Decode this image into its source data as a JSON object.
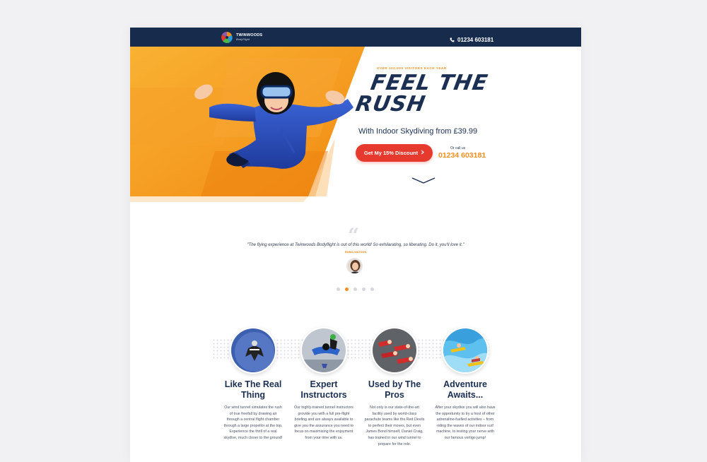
{
  "colors": {
    "navy": "#172c4c",
    "orange": "#f28d1c",
    "cta_red": "#e53a2d",
    "background": "#f1f1f3"
  },
  "header": {
    "logo_name": "TWINWOODS",
    "logo_sub": "BodyFlight",
    "phone_icon": "phone-icon",
    "phone": "01234 603181"
  },
  "hero": {
    "eyebrow": "OVER 100,000 VISITORS EACH YEAR",
    "headline_line1": "FEEL THE",
    "headline_line2": "RUSH",
    "subhead": "With Indoor Skydiving from £39.99",
    "cta_label": "Get My 15% Discount",
    "cta_icon": "chevron-right-icon",
    "or_call_label": "Or call us",
    "or_call_number": "01234 603181",
    "scroll_icon": "chevron-down-icon"
  },
  "testimonial": {
    "quote_icon": "quote-icon",
    "text": "\"The flying experience at Twinwoods Bodyflight is out of this world! So exhilarating, so liberating. Do it, you'll love it.\"",
    "author": "EMMA WATSON",
    "slide_count": 5,
    "active_slide": 2
  },
  "features": [
    {
      "title": "Like The Real Thing",
      "body": "Our wind tunnel simulates the rush of true freefall by drawing air through a central flight chamber through a large propellor at the top. Experience the thrill of a real skydive, much closer to the ground!"
    },
    {
      "title": "Expert Instructors",
      "body": "Our highly-trained tunnel instructors provide you with a full pre-flight briefing and are always available to give you the assurance you need to focus on maximising the enjoyment from your time with us."
    },
    {
      "title": "Used by The Pros",
      "body": "Not only is our state-of-the-art facility used by world-class parachute teams like the Red Devils to perfect their moves, but even James Bond himself, Daniel Craig, has trained in our wind tunnel to prepare for the role."
    },
    {
      "title": "Adventure Awaits...",
      "body": "After your skydive you will also have the opportunity to try a host of other adrenaline-fuelled activities – from riding the waves of our indoor surf machine, to testing your nerve with our famous vertigo jump!"
    }
  ]
}
